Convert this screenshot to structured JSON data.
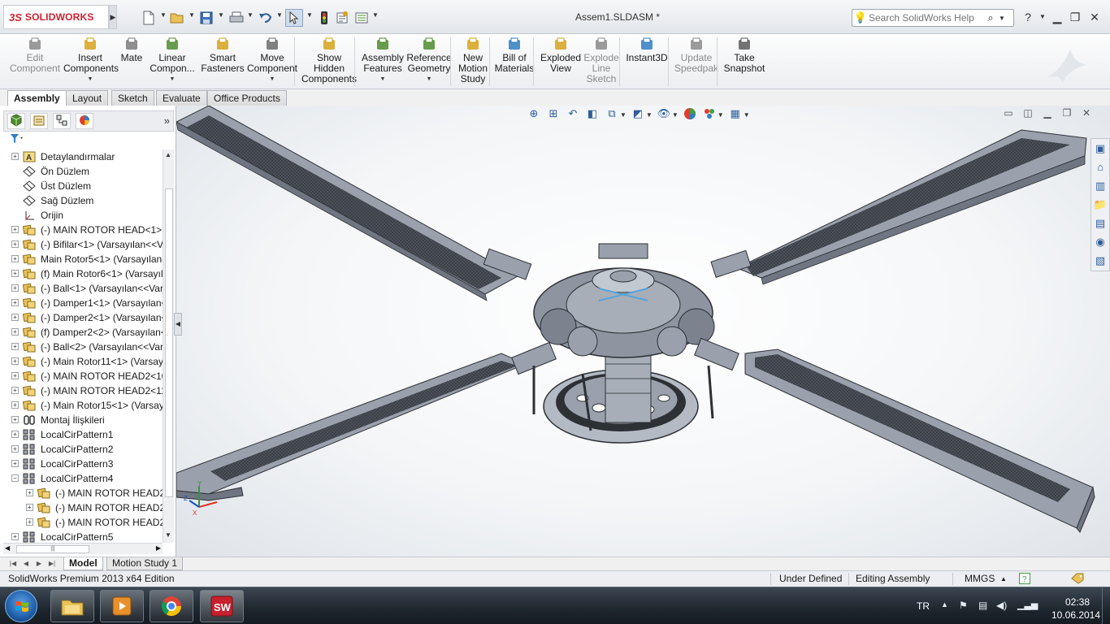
{
  "app": {
    "brand_ds": "3S",
    "brand_text": "SOLIDWORKS",
    "document_title": "Assem1.SLDASM *"
  },
  "quick_access": {
    "icons": [
      "new-icon",
      "open-icon",
      "save-icon",
      "print-icon",
      "undo-icon",
      "select-icon",
      "rebuild-icon",
      "file-properties-icon",
      "options-icon"
    ]
  },
  "help_search": {
    "placeholder": "Search SolidWorks Help"
  },
  "command_manager": {
    "commands": [
      {
        "id": "edit-component",
        "label1": "Edit",
        "label2": "Component",
        "label3": "",
        "disabled": true,
        "dropdown": false,
        "color": "#8a8a8a"
      },
      {
        "id": "insert-components",
        "label1": "Insert",
        "label2": "Components",
        "label3": "",
        "disabled": false,
        "dropdown": true,
        "color": "#d6a21b"
      },
      {
        "id": "mate",
        "label1": "Mate",
        "label2": "",
        "label3": "",
        "disabled": false,
        "dropdown": false,
        "color": "#7a7a7a"
      },
      {
        "id": "linear-component-pattern",
        "label1": "Linear",
        "label2": "Compon...",
        "label3": "",
        "disabled": false,
        "dropdown": true,
        "color": "#4c8c2b"
      },
      {
        "id": "smart-fasteners",
        "label1": "Smart",
        "label2": "Fasteners",
        "label3": "",
        "disabled": false,
        "dropdown": false,
        "color": "#d6a21b"
      },
      {
        "id": "move-component",
        "label1": "Move",
        "label2": "Component",
        "label3": "",
        "disabled": false,
        "dropdown": true,
        "color": "#6b6b6b"
      },
      {
        "id": "show-hidden-components",
        "label1": "Show",
        "label2": "Hidden",
        "label3": "Components",
        "disabled": false,
        "dropdown": false,
        "color": "#d6a21b"
      },
      {
        "id": "assembly-features",
        "label1": "Assembly",
        "label2": "Features",
        "label3": "",
        "disabled": false,
        "dropdown": true,
        "color": "#4c8c2b"
      },
      {
        "id": "reference-geometry",
        "label1": "Reference",
        "label2": "Geometry",
        "label3": "",
        "disabled": false,
        "dropdown": true,
        "color": "#4c8c2b"
      },
      {
        "id": "new-motion-study",
        "label1": "New",
        "label2": "Motion",
        "label3": "Study",
        "disabled": false,
        "dropdown": false,
        "color": "#d6a21b"
      },
      {
        "id": "bill-of-materials",
        "label1": "Bill of",
        "label2": "Materials",
        "label3": "",
        "disabled": false,
        "dropdown": false,
        "color": "#2f7fbf"
      },
      {
        "id": "exploded-view",
        "label1": "Exploded",
        "label2": "View",
        "label3": "",
        "disabled": false,
        "dropdown": false,
        "color": "#d6a21b"
      },
      {
        "id": "explode-line-sketch",
        "label1": "Explode",
        "label2": "Line",
        "label3": "Sketch",
        "disabled": true,
        "dropdown": false,
        "color": "#8a8a8a"
      },
      {
        "id": "instant3d",
        "label1": "Instant3D",
        "label2": "",
        "label3": "",
        "disabled": false,
        "dropdown": false,
        "color": "#2f7fbf"
      },
      {
        "id": "update-speedpak",
        "label1": "Update",
        "label2": "Speedpak",
        "label3": "",
        "disabled": true,
        "dropdown": false,
        "color": "#8a8a8a"
      },
      {
        "id": "take-snapshot",
        "label1": "Take",
        "label2": "Snapshot",
        "label3": "",
        "disabled": false,
        "dropdown": false,
        "color": "#5a5a5a"
      }
    ]
  },
  "tabs": [
    {
      "label": "Assembly",
      "active": true
    },
    {
      "label": "Layout",
      "active": false
    },
    {
      "label": "Sketch",
      "active": false
    },
    {
      "label": "Evaluate",
      "active": false
    },
    {
      "label": "Office Products",
      "active": false
    }
  ],
  "feature_tree": {
    "nodes": [
      {
        "label": "Detaylandırmalar",
        "icon": "annotations-icon",
        "level": 0,
        "expander": "+"
      },
      {
        "label": "Ön Düzlem",
        "icon": "plane-icon",
        "level": 0,
        "expander": ""
      },
      {
        "label": "Üst Düzlem",
        "icon": "plane-icon",
        "level": 0,
        "expander": ""
      },
      {
        "label": "Sağ Düzlem",
        "icon": "plane-icon",
        "level": 0,
        "expander": ""
      },
      {
        "label": "Orijin",
        "icon": "origin-icon",
        "level": 0,
        "expander": ""
      },
      {
        "label": "(-) MAIN ROTOR HEAD<1> (",
        "icon": "assembly-component-icon",
        "level": 0,
        "expander": "+"
      },
      {
        "label": "(-) Bifilar<1> (Varsayılan<<V",
        "icon": "assembly-component-icon",
        "level": 0,
        "expander": "+"
      },
      {
        "label": "Main Rotor5<1> (Varsayılan-",
        "icon": "assembly-component-icon",
        "level": 0,
        "expander": "+"
      },
      {
        "label": "(f) Main Rotor6<1> (Varsayıl",
        "icon": "assembly-component-icon",
        "level": 0,
        "expander": "+"
      },
      {
        "label": "(-) Ball<1> (Varsayılan<<Var",
        "icon": "assembly-component-icon",
        "level": 0,
        "expander": "+"
      },
      {
        "label": "(-) Damper1<1> (Varsayılan<",
        "icon": "assembly-component-icon",
        "level": 0,
        "expander": "+"
      },
      {
        "label": "(-) Damper2<1> (Varsayılan<",
        "icon": "assembly-component-icon",
        "level": 0,
        "expander": "+"
      },
      {
        "label": "(f) Damper2<2> (Varsayılan<",
        "icon": "assembly-component-icon",
        "level": 0,
        "expander": "+"
      },
      {
        "label": "(-) Ball<2> (Varsayılan<<Var",
        "icon": "assembly-component-icon",
        "level": 0,
        "expander": "+"
      },
      {
        "label": "(-) Main Rotor11<1> (Varsay",
        "icon": "assembly-component-icon",
        "level": 0,
        "expander": "+"
      },
      {
        "label": "(-) MAIN ROTOR HEAD2<10",
        "icon": "assembly-component-icon",
        "level": 0,
        "expander": "+"
      },
      {
        "label": "(-) MAIN ROTOR HEAD2<11",
        "icon": "assembly-component-icon",
        "level": 0,
        "expander": "+"
      },
      {
        "label": "(-) Main Rotor15<1> (Varsay",
        "icon": "assembly-component-icon",
        "level": 0,
        "expander": "+"
      },
      {
        "label": "Montaj İlişkileri",
        "icon": "mates-icon",
        "level": 0,
        "expander": "+"
      },
      {
        "label": "LocalCirPattern1",
        "icon": "circular-pattern-icon",
        "level": 0,
        "expander": "+"
      },
      {
        "label": "LocalCirPattern2",
        "icon": "circular-pattern-icon",
        "level": 0,
        "expander": "+"
      },
      {
        "label": "LocalCirPattern3",
        "icon": "circular-pattern-icon",
        "level": 0,
        "expander": "+"
      },
      {
        "label": "LocalCirPattern4",
        "icon": "circular-pattern-icon",
        "level": 0,
        "expander": "−"
      },
      {
        "label": "(-) MAIN ROTOR HEAD2",
        "icon": "assembly-component-icon",
        "level": 1,
        "expander": "+"
      },
      {
        "label": "(-) MAIN ROTOR HEAD2",
        "icon": "assembly-component-icon",
        "level": 1,
        "expander": "+"
      },
      {
        "label": "(-) MAIN ROTOR HEAD2",
        "icon": "assembly-component-icon",
        "level": 1,
        "expander": "+"
      },
      {
        "label": "LocalCirPattern5",
        "icon": "circular-pattern-icon",
        "level": 0,
        "expander": "+"
      }
    ]
  },
  "bottom_tabs": [
    {
      "label": "Model",
      "active": true
    },
    {
      "label": "Motion Study 1",
      "active": false
    }
  ],
  "status_bar": {
    "product": "SolidWorks Premium 2013 x64 Edition",
    "definition": "Under Defined",
    "mode": "Editing Assembly",
    "units": "MMGS"
  },
  "taskbar": {
    "apps": [
      "file-explorer-icon",
      "media-player-icon",
      "chrome-icon",
      "solidworks-icon"
    ],
    "language": "TR",
    "time": "02:38",
    "date": "10.06.2014"
  },
  "colors": {
    "brand_red": "#d01f2e",
    "model_gray": "#9aa1ad",
    "model_dark": "#3a3e45",
    "accent_blue": "#2f5f99"
  }
}
